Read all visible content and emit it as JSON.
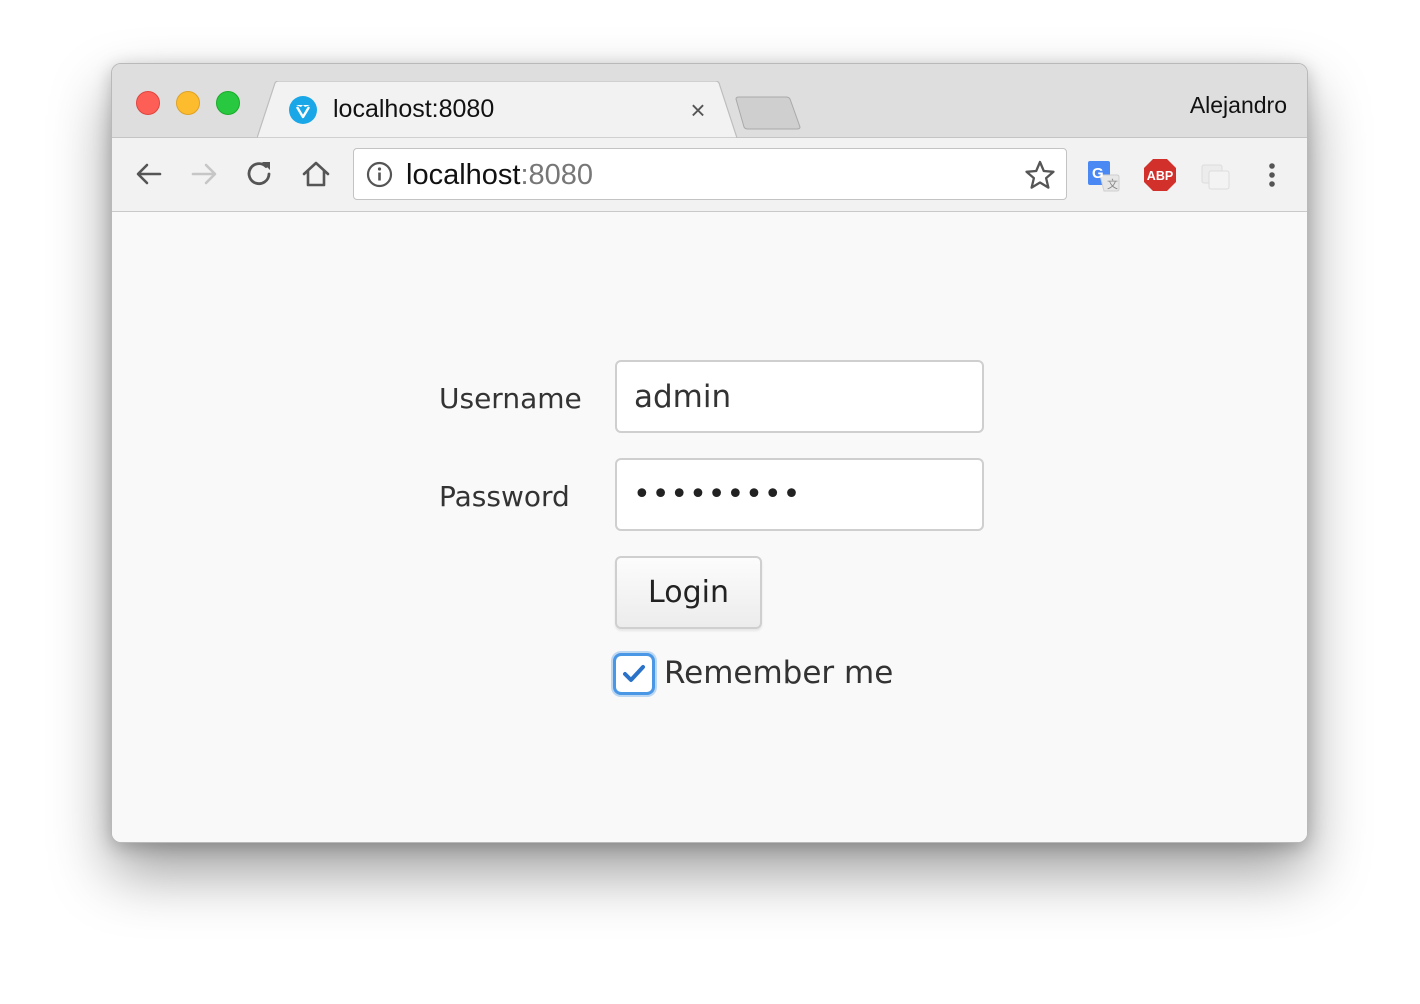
{
  "browser": {
    "tab": {
      "title": "localhost:8080",
      "close_glyph": "×",
      "favicon": "vaadin-logo-icon"
    },
    "profile_name": "Alejandro",
    "address_bar": {
      "host": "localhost",
      "port": ":8080"
    },
    "extensions": [
      "google-translate-icon",
      "adblock-plus-icon",
      "cast-icon"
    ]
  },
  "login_form": {
    "username": {
      "label": "Username",
      "value": "admin"
    },
    "password": {
      "label": "Password",
      "masked_value": "•••••••••"
    },
    "login_button": "Login",
    "remember_me": {
      "label": "Remember me",
      "checked": true
    }
  },
  "colors": {
    "traffic_red": "#fd5f57",
    "traffic_yellow": "#fdbc2e",
    "traffic_green": "#28c840",
    "checkbox_accent": "#4a97e6",
    "abp_red": "#d1302b",
    "translate_blue": "#4a89f3"
  }
}
